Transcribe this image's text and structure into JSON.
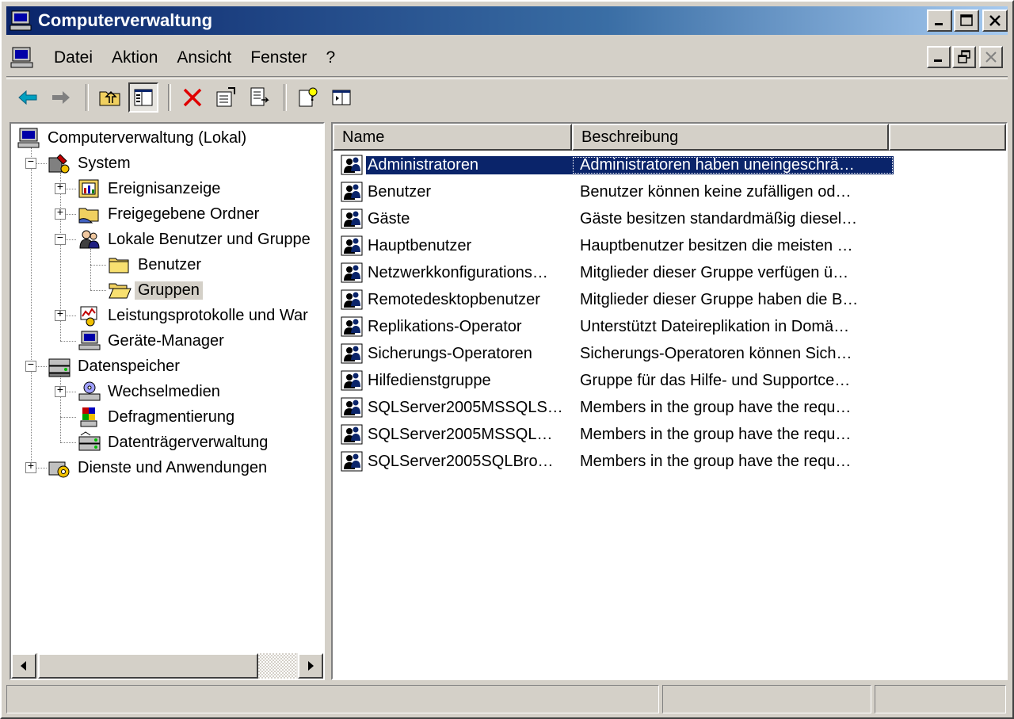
{
  "window": {
    "title": "Computerverwaltung",
    "controls": [
      "minimize",
      "maximize",
      "close"
    ]
  },
  "menubar": {
    "items": [
      {
        "label": "Datei",
        "accel": "D"
      },
      {
        "label": "Aktion",
        "accel": "k"
      },
      {
        "label": "Ansicht",
        "accel": "A"
      },
      {
        "label": "Fenster",
        "accel": "F"
      },
      {
        "label": "?",
        "accel": "?"
      }
    ]
  },
  "toolbar": {
    "buttons": [
      "back-icon",
      "forward-icon",
      "up-folder-icon",
      "show-hide-tree-icon",
      "delete-icon",
      "properties-icon",
      "export-list-icon",
      "help-icon",
      "action-pane-icon"
    ]
  },
  "tree": {
    "root": "Computerverwaltung (Lokal)",
    "system": "System",
    "ereignisanzeige": "Ereignisanzeige",
    "freigegebene_ordner": "Freigegebene Ordner",
    "lokale_benutzer": "Lokale Benutzer und Gruppe",
    "benutzer": "Benutzer",
    "gruppen": "Gruppen",
    "leistungsprotokolle": "Leistungsprotokolle und War",
    "geraete_manager": "Geräte-Manager",
    "datenspeicher": "Datenspeicher",
    "wechselmedien": "Wechselmedien",
    "defragmentierung": "Defragmentierung",
    "datentraegerverwaltung": "Datenträgerverwaltung",
    "dienste": "Dienste und Anwendungen",
    "selected": "Gruppen"
  },
  "list": {
    "columns": {
      "name": "Name",
      "description": "Beschreibung"
    },
    "rows": [
      {
        "name": "Administratoren",
        "description": "Administratoren haben uneingeschrä…",
        "selected": true
      },
      {
        "name": "Benutzer",
        "description": "Benutzer können keine zufälligen od…"
      },
      {
        "name": "Gäste",
        "description": "Gäste besitzen standardmäßig diesel…"
      },
      {
        "name": "Hauptbenutzer",
        "description": "Hauptbenutzer besitzen die meisten …"
      },
      {
        "name": "Netzwerkkonfigurations…",
        "description": "Mitglieder dieser Gruppe verfügen ü…"
      },
      {
        "name": "Remotedesktopbenutzer",
        "description": "Mitglieder dieser Gruppe haben die B…"
      },
      {
        "name": "Replikations-Operator",
        "description": "Unterstützt Dateireplikation in Domä…"
      },
      {
        "name": "Sicherungs-Operatoren",
        "description": "Sicherungs-Operatoren können Sich…"
      },
      {
        "name": "Hilfedienstgruppe",
        "description": "Gruppe für das Hilfe- und Supportce…"
      },
      {
        "name": "SQLServer2005MSSQLS…",
        "description": "Members in the group have the requ…"
      },
      {
        "name": "SQLServer2005MSSQL…",
        "description": "Members in the group have the requ…"
      },
      {
        "name": "SQLServer2005SQLBro…",
        "description": "Members in the group have the requ…"
      }
    ]
  },
  "statusbar": {
    "panels": [
      "",
      "",
      ""
    ]
  },
  "colors": {
    "title_start": "#0a246a",
    "title_end": "#a6caf0",
    "selection": "#0a246a",
    "face": "#d4d0c8"
  }
}
